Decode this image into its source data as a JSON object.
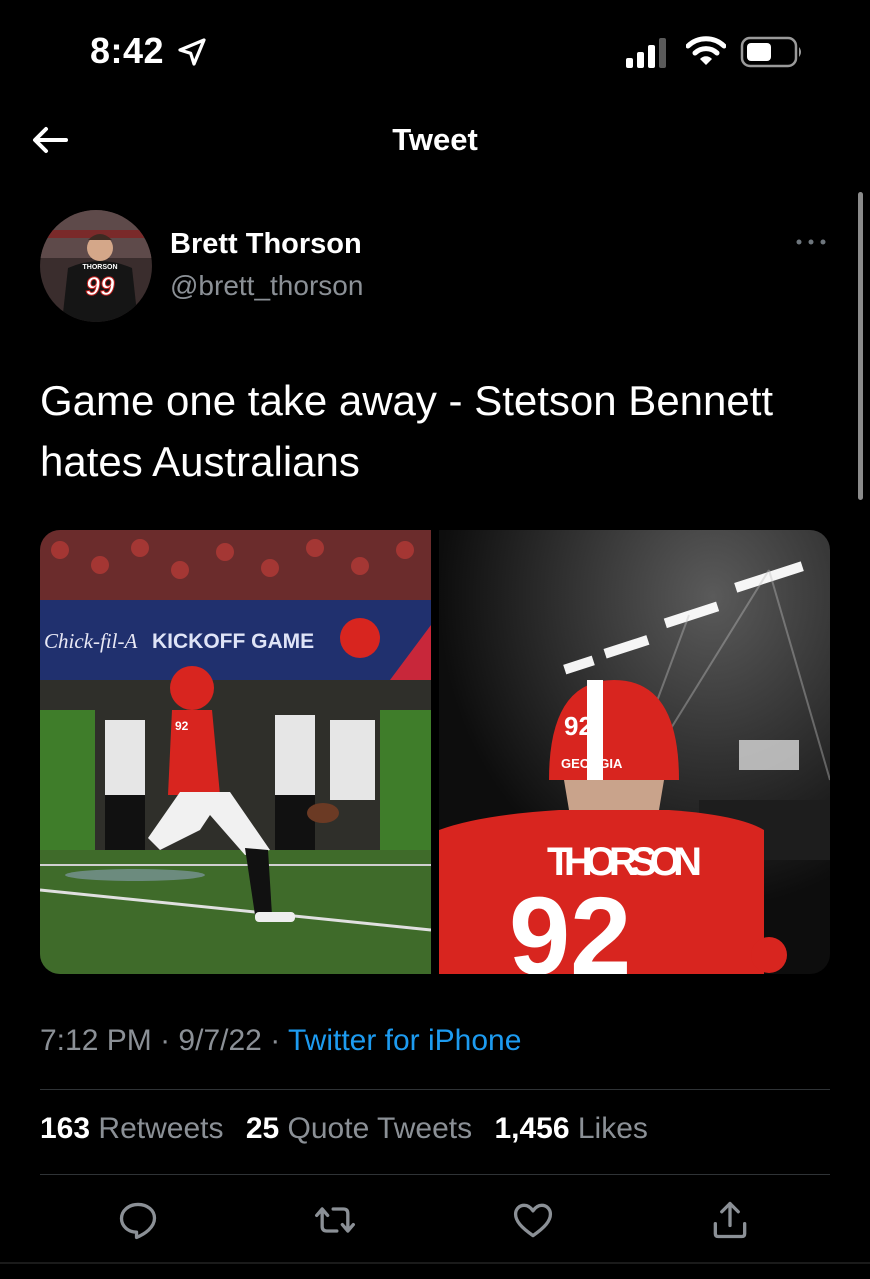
{
  "status_bar": {
    "time": "8:42",
    "location_icon": "location-arrow-icon",
    "signal_icon": "cellular-signal-icon",
    "wifi_icon": "wifi-icon",
    "battery_icon": "battery-icon"
  },
  "nav": {
    "title": "Tweet",
    "back_icon": "arrow-left-icon"
  },
  "tweet": {
    "author_name": "Brett Thorson",
    "author_handle": "@brett_thorson",
    "avatar_jersey_name": "THORSON",
    "avatar_jersey_number": "99",
    "more_icon": "more-horizontal-icon",
    "text_line1": "Game one take away - Stetson Bennett",
    "text_line2": "hates Australians",
    "photos": [
      {
        "description": "kicker",
        "jersey_number": "92",
        "banner_text": "KICKOFF GAME",
        "banner_brand": "Chick-fil-A"
      },
      {
        "description": "back of player",
        "jersey_name": "THORSON",
        "jersey_number": "92",
        "helmet_text": "GEORGIA"
      }
    ],
    "time": "7:12 PM",
    "date": "9/7/22",
    "separator": "·",
    "source": "Twitter for iPhone",
    "retweets_count": "163",
    "retweets_label": "Retweets",
    "quotes_count": "25",
    "quotes_label": "Quote Tweets",
    "likes_count": "1,456",
    "likes_label": "Likes"
  },
  "actions": [
    {
      "name": "reply",
      "icon": "reply-icon"
    },
    {
      "name": "retweet",
      "icon": "retweet-icon"
    },
    {
      "name": "like",
      "icon": "heart-icon"
    },
    {
      "name": "share",
      "icon": "share-icon"
    }
  ],
  "colors": {
    "background": "#000000",
    "text": "#ffffff",
    "secondary_text": "#8b9096",
    "link": "#1d9bf0",
    "divider": "#2f3336",
    "georgia_red": "#d8251f"
  }
}
